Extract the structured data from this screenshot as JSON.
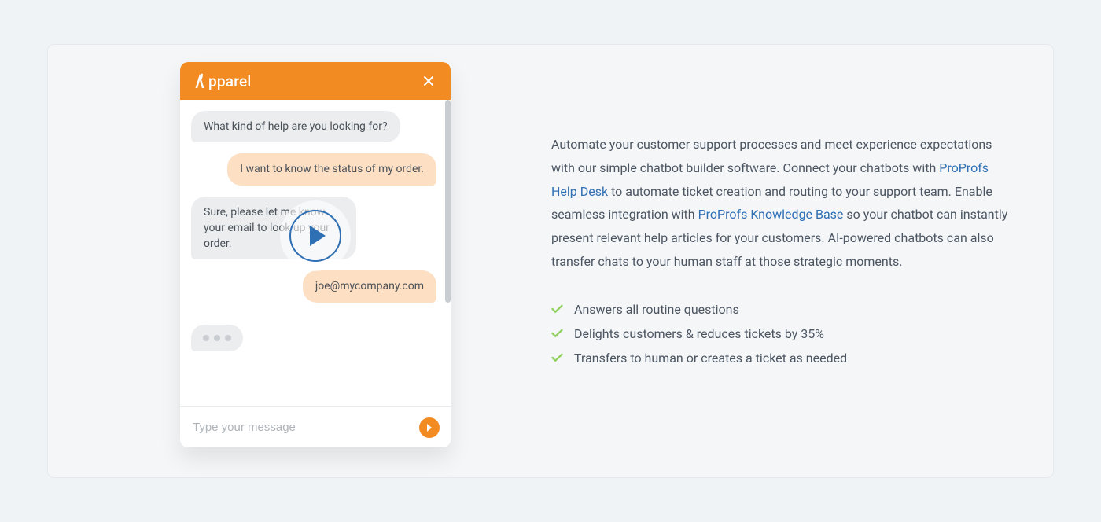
{
  "chat": {
    "brand": "pparel",
    "messages": {
      "m1": "What kind of help are you looking for?",
      "m2": "I want to know the status of my order.",
      "m3": "Sure, please let me know your email to look up your order.",
      "m4": "joe@mycompany.com"
    },
    "input_placeholder": "Type your message"
  },
  "desc": {
    "p1": "Automate your customer support processes and meet experience expectations with our simple chatbot builder software. Connect your chatbots with ",
    "link1": "ProProfs Help Desk",
    "p2": " to automate ticket creation and routing to your support team. Enable seamless integration with ",
    "link2": "ProProfs Knowledge Base",
    "p3": " so your chatbot can instantly present relevant help articles for your customers. AI-powered chatbots can also transfer chats to your human staff at those strategic moments."
  },
  "features": {
    "f1": "Answers all routine questions",
    "f2": "Delights customers & reduces tickets by 35%",
    "f3": "Transfers to human or creates a ticket as needed"
  }
}
